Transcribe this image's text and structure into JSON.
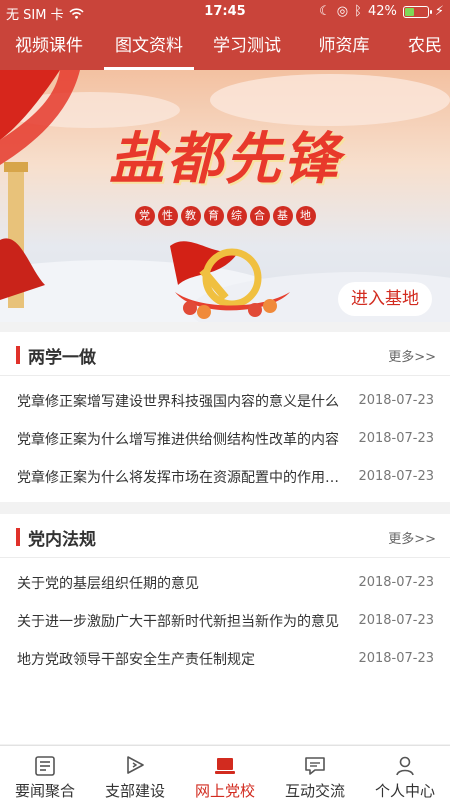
{
  "status": {
    "carrier": "无 SIM 卡",
    "time": "17:45",
    "battery": "42%",
    "battery_level": 0.42
  },
  "tabs": [
    {
      "label": "视频课件",
      "active": false
    },
    {
      "label": "图文资料",
      "active": true
    },
    {
      "label": "学习测试",
      "active": false
    },
    {
      "label": "师资库",
      "active": false
    },
    {
      "label": "农民",
      "active": false
    }
  ],
  "banner": {
    "title": "盐都先锋",
    "subtitle_chars": [
      "党",
      "性",
      "教",
      "育",
      "综",
      "合",
      "基",
      "地"
    ],
    "enter_label": "进入基地"
  },
  "sections": [
    {
      "title": "两学一做",
      "more": "更多>>",
      "items": [
        {
          "title": "党章修正案增写建设世界科技强国内容的意义是什么",
          "date": "2018-07-23"
        },
        {
          "title": "党章修正案为什么增写推进供给侧结构性改革的内容",
          "date": "2018-07-23"
        },
        {
          "title": "党章修正案为什么将发挥市场在资源配置中的作用写入",
          "date": "2018-07-23"
        }
      ]
    },
    {
      "title": "党内法规",
      "more": "更多>>",
      "items": [
        {
          "title": "关于党的基层组织任期的意见",
          "date": "2018-07-23"
        },
        {
          "title": "关于进一步激励广大干部新时代新担当新作为的意见",
          "date": "2018-07-23"
        },
        {
          "title": "地方党政领导干部安全生产责任制规定",
          "date": "2018-07-23"
        }
      ]
    }
  ],
  "bottom_nav": [
    {
      "label": "要闻聚合",
      "icon": "newspaper-icon",
      "active": false
    },
    {
      "label": "支部建设",
      "icon": "flag-icon",
      "active": false
    },
    {
      "label": "网上党校",
      "icon": "laptop-icon",
      "active": true
    },
    {
      "label": "互动交流",
      "icon": "chat-icon",
      "active": false
    },
    {
      "label": "个人中心",
      "icon": "person-icon",
      "active": false
    }
  ],
  "colors": {
    "primary": "#c9443a",
    "accent": "#d22b1f",
    "marker": "#e0312a"
  }
}
